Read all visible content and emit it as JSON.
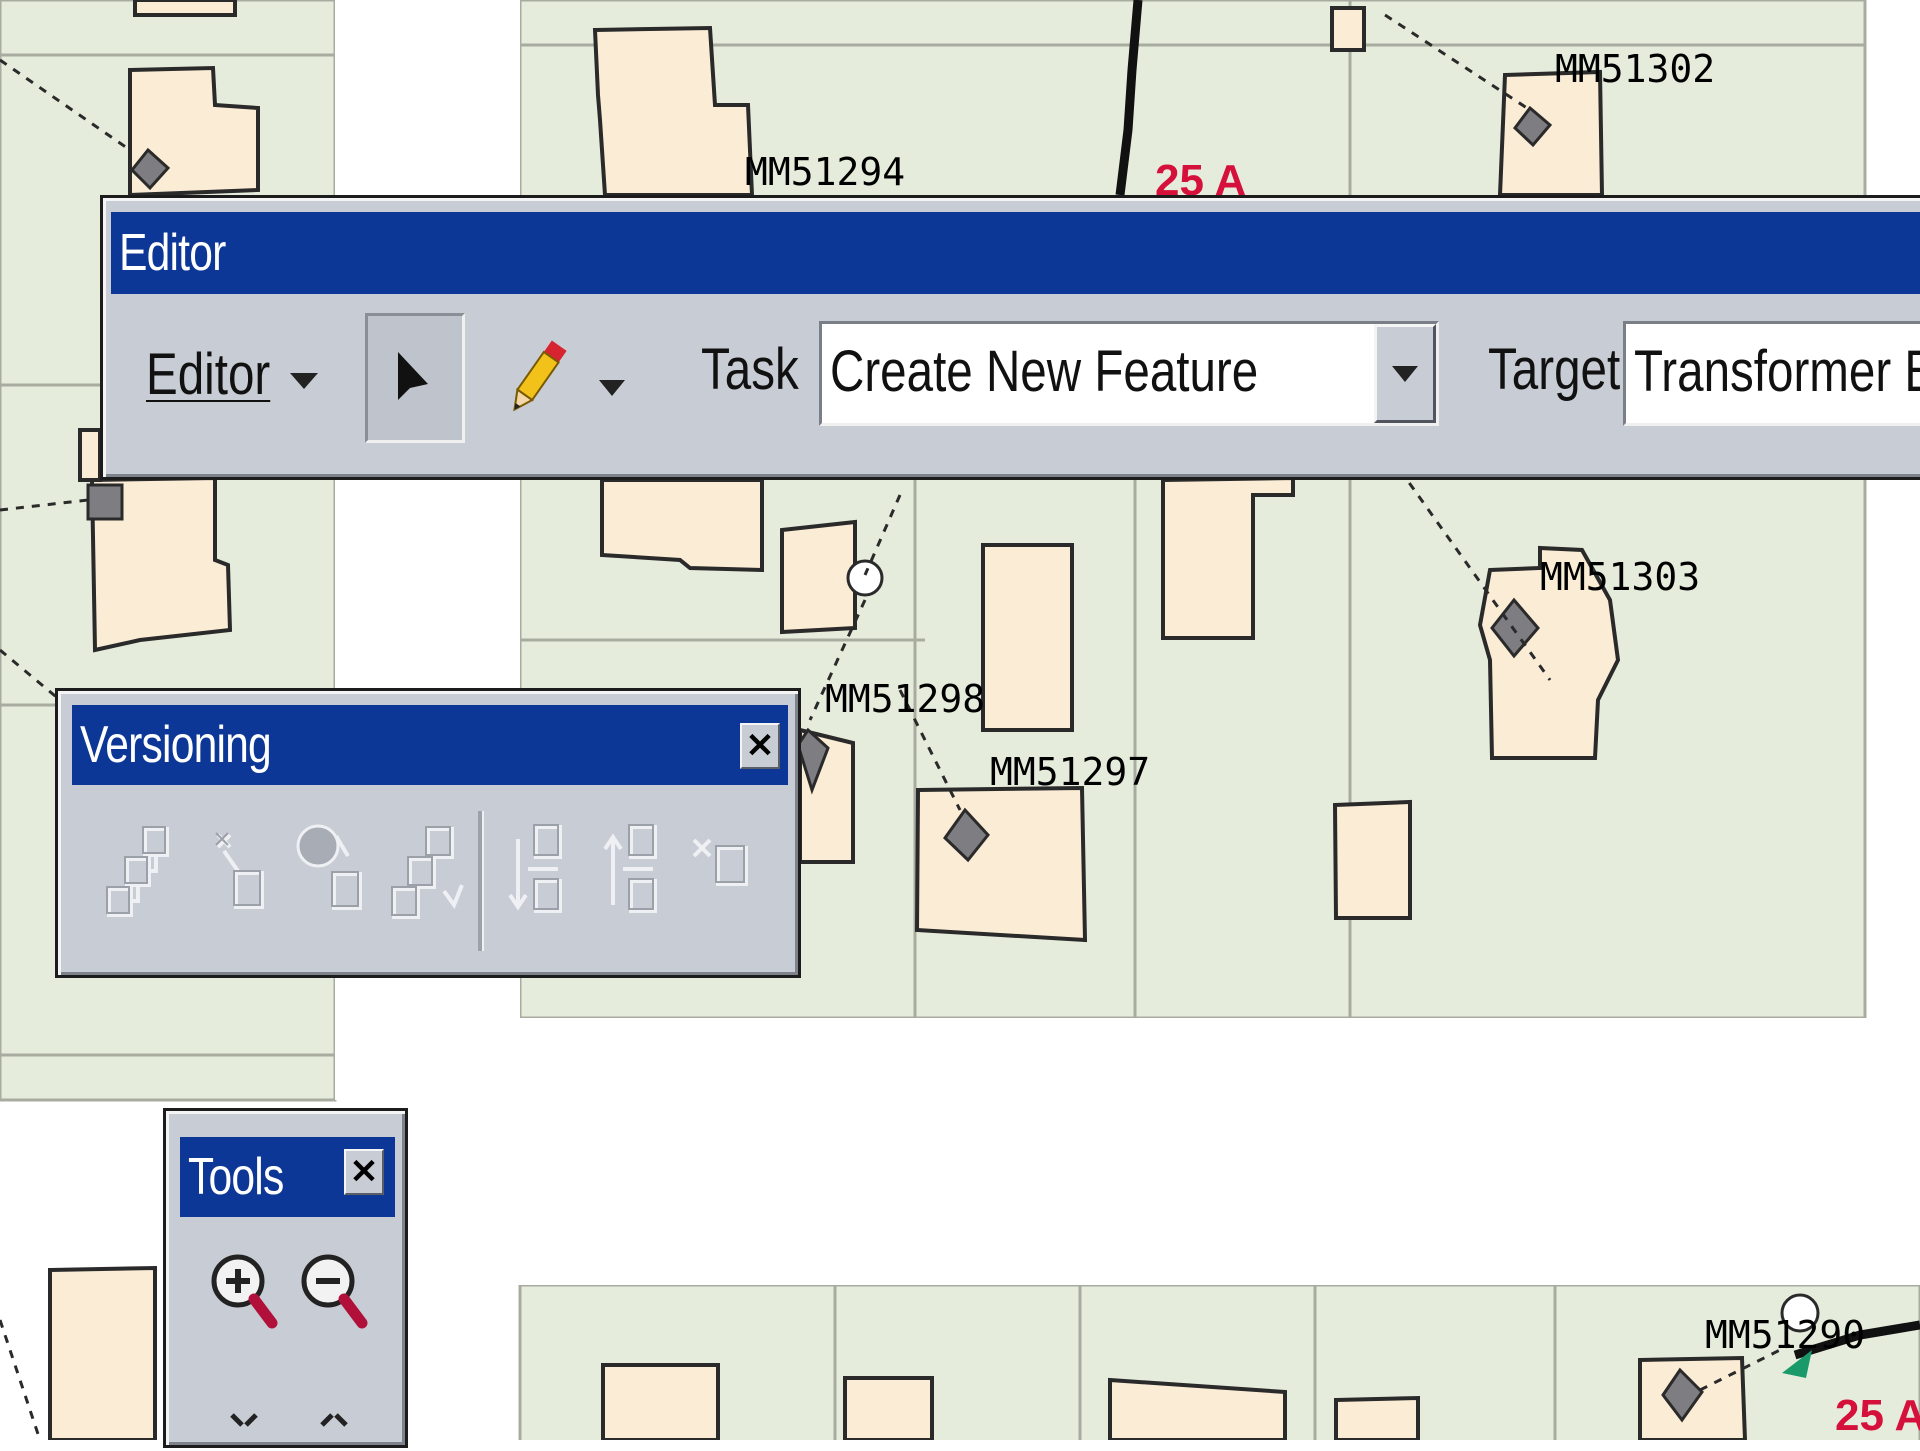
{
  "map": {
    "feature_labels": [
      "MM51302",
      "MM51294",
      "MM51303",
      "MM51298",
      "MM51297",
      "MM51290"
    ],
    "amp_labels": [
      "25 A",
      "25 A"
    ]
  },
  "editor_toolbar": {
    "title": "Editor",
    "menu_label": "Editor",
    "task_label": "Task",
    "task_value": "Create New Feature",
    "target_label": "Target",
    "target_value": "Transformer Ba"
  },
  "versioning_toolbar": {
    "title": "Versioning",
    "close_icon": "close-icon",
    "buttons": [
      "version-manager-icon",
      "create-new-version-icon",
      "change-version-icon",
      "refresh-version-icon",
      "reconcile-icon",
      "post-icon",
      "delete-version-icon"
    ]
  },
  "tools_toolbar": {
    "title": "Tools",
    "close_icon": "close-icon",
    "buttons": [
      "zoom-in-icon",
      "zoom-out-icon",
      "fixed-zoom-in-icon",
      "fixed-zoom-out-icon"
    ]
  },
  "colors": {
    "titlebar": "#0d3796",
    "toolbar_bg": "#c8ccd4",
    "parcel_fill": "#e6ecdc",
    "building_fill": "#fbecd6",
    "amp_label": "#d4103b"
  }
}
